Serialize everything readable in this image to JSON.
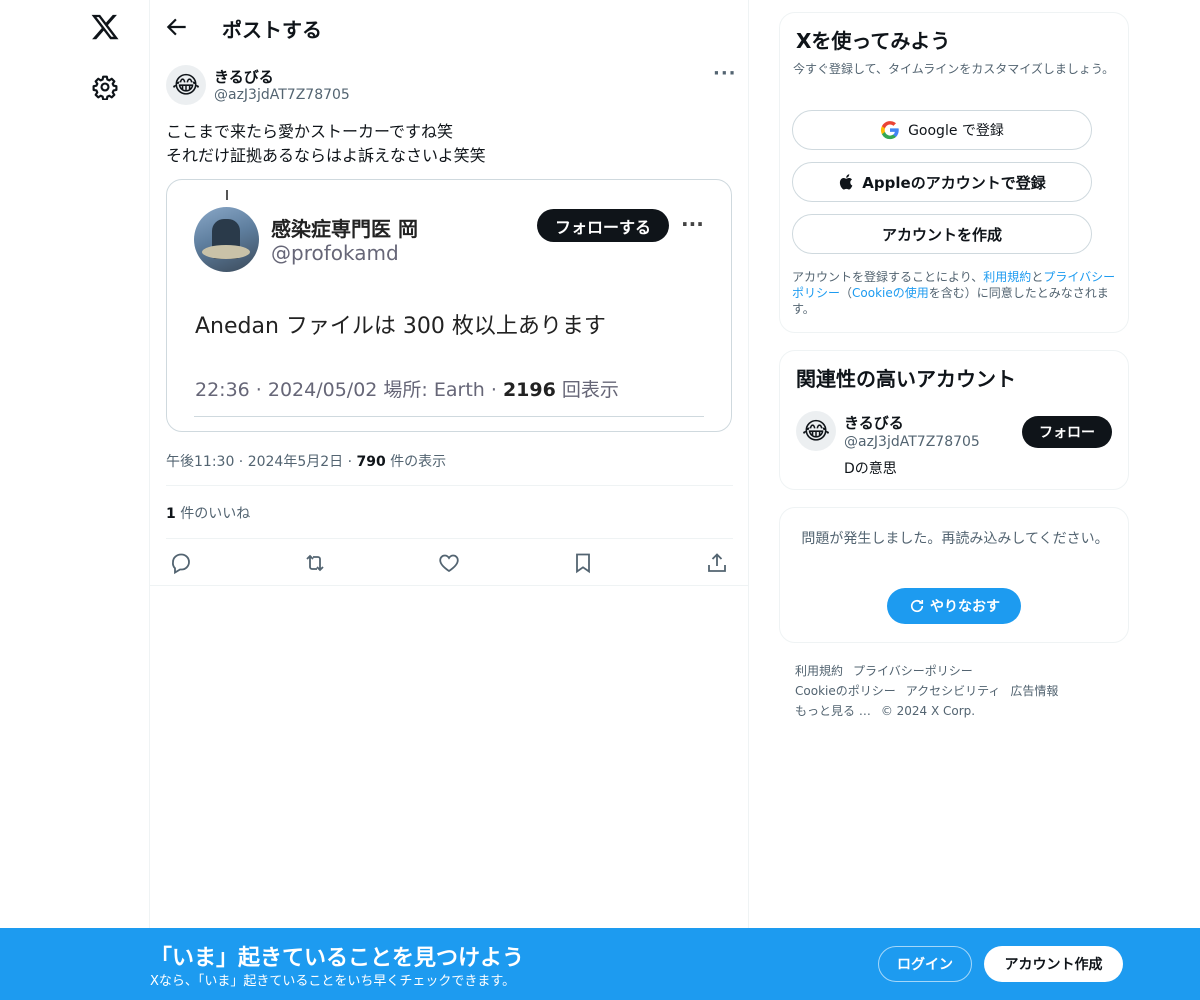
{
  "nav": {
    "logo_icon": "x-logo-icon",
    "settings_icon": "gear-icon"
  },
  "header": {
    "title": "ポストする"
  },
  "post": {
    "author_name": "きるびる",
    "author_handle": "@azJ3jdAT7Z78705",
    "avatar_emoji": "😂",
    "text_line1": "ここまで来たら愛かストーカーですね笑",
    "text_line2": "それだけ証拠あるならはよ訴えなさいよ笑笑",
    "more": "···",
    "timestamp": "午後11:30 · 2024年5月2日 · ",
    "views_count": "790",
    "views_label": " 件の表示",
    "likes_count": "1",
    "likes_label": " 件のいいね"
  },
  "embedded": {
    "name": "感染症専門医 岡",
    "handle": "@profokamd",
    "follow_label": "フォローする",
    "more": "···",
    "body": "Anedan ファイルは 300 枚以上あります",
    "meta": "22:36 · 2024/05/02 場所: Earth · ",
    "views_count": "2196",
    "views_label": " 回表示"
  },
  "actions": [
    "reply-icon",
    "repost-icon",
    "like-icon",
    "bookmark-icon",
    "share-icon"
  ],
  "signup_box": {
    "title": "Xを使ってみよう",
    "subtitle": "今すぐ登録して、タイムラインをカスタマイズしましょう。",
    "google_label": "Google で登録",
    "apple_label": "Appleのアカウントで登録",
    "create_label": "アカウントを作成",
    "terms_prefix": "アカウントを登録することにより、",
    "terms_link": "利用規約",
    "terms_and": "と",
    "privacy_link": "プライバシーポリシー",
    "terms_paren_open": "（",
    "cookie_link": "Cookieの使用",
    "terms_suffix": "を含む）に同意したとみなされます。"
  },
  "related": {
    "title": "関連性の高いアカウント",
    "name": "きるびる",
    "handle": "@azJ3jdAT7Z78705",
    "bio": "Dの意思",
    "avatar_emoji": "😂",
    "follow_label": "フォロー"
  },
  "error_box": {
    "text": "問題が発生しました。再読み込みしてください。",
    "retry_label": "やりなおす"
  },
  "footer": {
    "terms": "利用規約",
    "privacy": "プライバシーポリシー",
    "cookie": "Cookieのポリシー",
    "accessibility": "アクセシビリティ",
    "ads": "広告情報",
    "more": "もっと見る …",
    "copyright": "© 2024 X Corp."
  },
  "banner": {
    "title": "「いま」起きていることを見つけよう",
    "subtitle": "Xなら、「いま」起きていることをいち早くチェックできます。",
    "login_label": "ログイン",
    "signup_label": "アカウント作成"
  },
  "colors": {
    "accent": "#1d9bf0",
    "text": "#0f1419",
    "muted": "#536471",
    "border": "#eff3f4"
  }
}
